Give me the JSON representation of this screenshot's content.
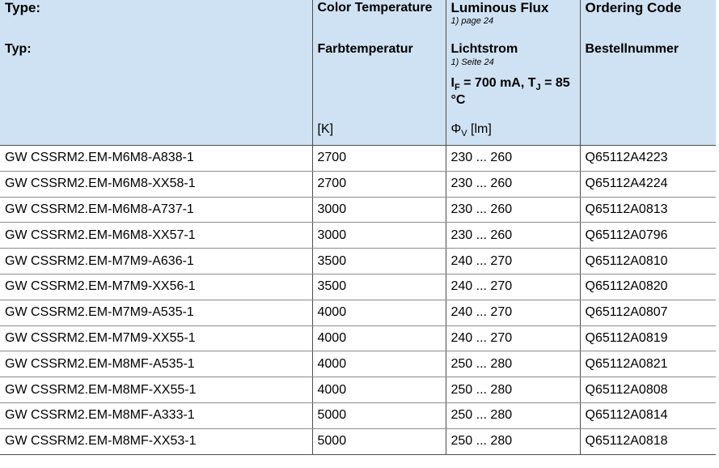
{
  "header": {
    "type_en": "Type:",
    "type_de": "Typ:",
    "color_temp_en": "Color Temperature",
    "color_temp_de": "Farbtemperatur",
    "color_temp_unit": "[K]",
    "flux_en": "Luminous Flux",
    "flux_en_note": "1) page 24",
    "flux_de": "Lichtstrom",
    "flux_de_note": "1) Seite 24",
    "flux_cond_if": "I",
    "flux_cond_if_sub": "F",
    "flux_cond_mid": " = 700 mA, T",
    "flux_cond_tj_sub": "J",
    "flux_cond_end": " = 85 °C",
    "flux_unit_phi": "Φ",
    "flux_unit_phi_sub": "V",
    "flux_unit_lm": " [lm]",
    "order_en": "Ordering Code",
    "order_de": "Bestellnummer"
  },
  "rows": [
    {
      "type": "GW CSSRM2.EM-M6M8-A838-1",
      "temp": "2700",
      "flux": "230 ... 260",
      "code": "Q65112A4223"
    },
    {
      "type": "GW CSSRM2.EM-M6M8-XX58-1",
      "temp": "2700",
      "flux": "230 ... 260",
      "code": "Q65112A4224"
    },
    {
      "type": "GW CSSRM2.EM-M6M8-A737-1",
      "temp": "3000",
      "flux": "230 ... 260",
      "code": "Q65112A0813"
    },
    {
      "type": "GW CSSRM2.EM-M6M8-XX57-1",
      "temp": "3000",
      "flux": "230 ... 260",
      "code": "Q65112A0796"
    },
    {
      "type": "GW CSSRM2.EM-M7M9-A636-1",
      "temp": "3500",
      "flux": "240 ... 270",
      "code": "Q65112A0810"
    },
    {
      "type": "GW CSSRM2.EM-M7M9-XX56-1",
      "temp": "3500",
      "flux": "240 ... 270",
      "code": "Q65112A0820"
    },
    {
      "type": "GW CSSRM2.EM-M7M9-A535-1",
      "temp": "4000",
      "flux": "240 ... 270",
      "code": "Q65112A0807"
    },
    {
      "type": "GW CSSRM2.EM-M7M9-XX55-1",
      "temp": "4000",
      "flux": "240 ... 270",
      "code": "Q65112A0819"
    },
    {
      "type": "GW CSSRM2.EM-M8MF-A535-1",
      "temp": "4000",
      "flux": "250 ... 280",
      "code": "Q65112A0821"
    },
    {
      "type": "GW CSSRM2.EM-M8MF-XX55-1",
      "temp": "4000",
      "flux": "250 ... 280",
      "code": "Q65112A0808"
    },
    {
      "type": "GW CSSRM2.EM-M8MF-A333-1",
      "temp": "5000",
      "flux": "250 ... 280",
      "code": "Q65112A0814"
    },
    {
      "type": "GW CSSRM2.EM-M8MF-XX53-1",
      "temp": "5000",
      "flux": "250 ... 280",
      "code": "Q65112A0818"
    }
  ]
}
